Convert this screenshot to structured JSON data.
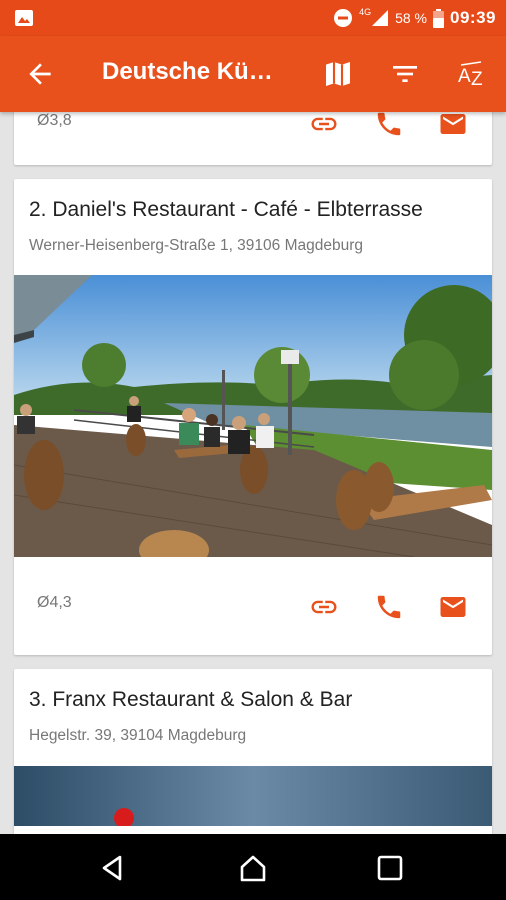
{
  "status_bar": {
    "network": "4G",
    "battery": "58 %",
    "time": "09:39"
  },
  "app_bar": {
    "title": "Deutsche Kü…",
    "icons": [
      "back-arrow-icon",
      "map-icon",
      "filter-icon",
      "sort-az-icon"
    ]
  },
  "restaurants": [
    {
      "rating": "Ø3,8"
    },
    {
      "title": "2. Daniel's Restaurant - Café - Elbterrasse",
      "address": "Werner-Heisenberg-Straße 1, 39106 Magdeburg",
      "rating": "Ø4,3"
    },
    {
      "title": "3. Franx Restaurant & Salon & Bar",
      "address": "Hegelstr.  39, 39104 Magdeburg"
    }
  ],
  "colors": {
    "primary": "#e8501c",
    "status_bar": "#e64a19",
    "accent_icon": "#e8501c"
  }
}
